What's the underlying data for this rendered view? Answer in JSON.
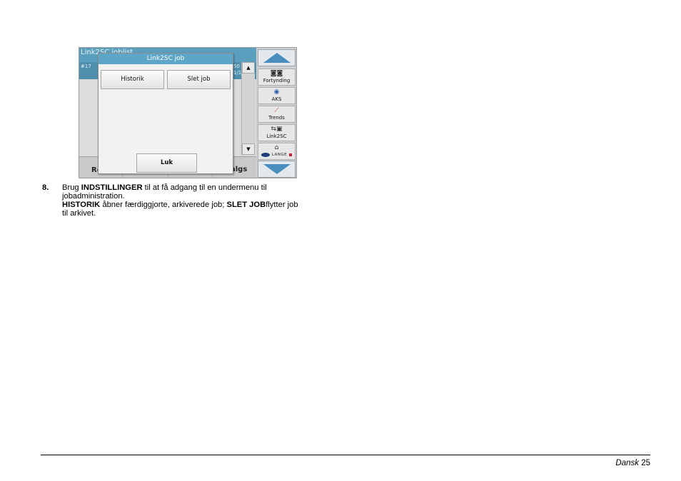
{
  "device": {
    "background_title": "Link2SC joblist",
    "list_left_label": "#17",
    "list_right_1": "50",
    "list_right_2": "1/1",
    "bottom_left_fragment": "Re",
    "bottom_right_fragment": "algs",
    "scroll_up_glyph": "▲",
    "scroll_down_glyph": "▼",
    "dialog": {
      "title": "Link2SC job",
      "historik_label": "Historik",
      "slet_label": "Slet job",
      "luk_label": "Luk"
    },
    "sidebar": [
      {
        "icon": "binoculars-icon",
        "glyph": "◙◙",
        "label": "Fortynding"
      },
      {
        "icon": "aks-icon",
        "glyph": "◉",
        "label": "AKS"
      },
      {
        "icon": "trends-icon",
        "glyph": "⟋",
        "label": "Trends"
      },
      {
        "icon": "link2sc-icon",
        "glyph": "⇆▣",
        "label": "Link2SC"
      },
      {
        "icon": "home-icon",
        "glyph": "⌂",
        "label": "LANGE"
      }
    ],
    "colors": {
      "header_blue": "#5b9fbe",
      "dialog_title_blue": "#5ea6c8",
      "arrow_blue": "#4a8ec0"
    }
  },
  "step": {
    "number": "8.",
    "line1_a": "Brug ",
    "line1_bold": "INDSTILLINGER",
    "line1_b": " til at få adgang til en undermenu til",
    "line2": "jobadministration.",
    "line3_bold1": "HISTORIK",
    "line3_a": " åbner færdiggjorte, arkiverede job; ",
    "line3_bold2": "SLET JOB",
    "line3_b": "flytter job",
    "line4": "til arkivet."
  },
  "footer": {
    "language": "Dansk",
    "page": "25"
  }
}
